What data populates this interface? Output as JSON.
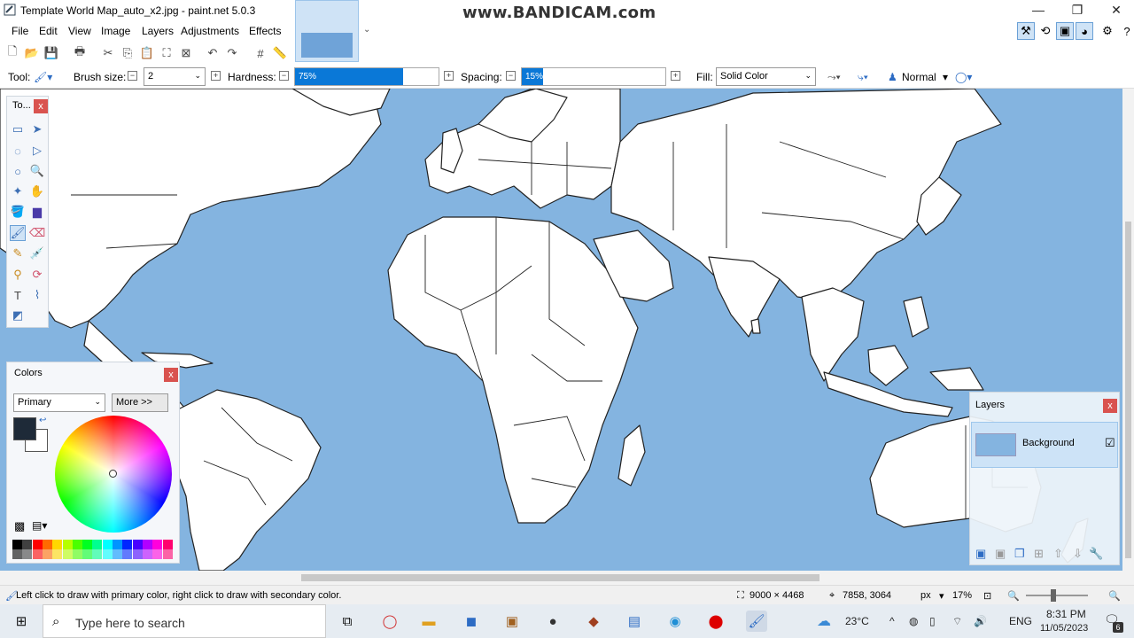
{
  "window": {
    "title": "Template World Map_auto_x2.jpg - paint.net 5.0.3",
    "watermark": "www.BANDICAM.com",
    "minimize": "—",
    "maximize": "❐",
    "close": "✕"
  },
  "menu": {
    "file": "File",
    "edit": "Edit",
    "view": "View",
    "image": "Image",
    "layers": "Layers",
    "adjustments": "Adjustments",
    "effects": "Effects"
  },
  "toolbar": {
    "tool_label": "Tool:",
    "brush_size_label": "Brush size:",
    "brush_size_value": "2",
    "hardness_label": "Hardness:",
    "hardness_value": "75%",
    "hardness_fraction": 0.75,
    "spacing_label": "Spacing:",
    "spacing_value": "15%",
    "spacing_fraction": 0.15,
    "fill_label": "Fill:",
    "fill_value": "Solid Color",
    "blend_mode": "Normal"
  },
  "tools_panel": {
    "title": "To...",
    "close": "x"
  },
  "colors_panel": {
    "title": "Colors",
    "close": "x",
    "mode": "Primary",
    "more_button": "More >>",
    "primary_color": "#1e2a38",
    "secondary_color": "#ffffff"
  },
  "layers_panel": {
    "title": "Layers",
    "close": "x",
    "layer_name": "Background"
  },
  "status": {
    "hint": "Left click to draw with primary color, right click to draw with secondary color.",
    "image_size": "9000 × 4468",
    "cursor_pos": "7858, 3064",
    "units": "px",
    "zoom": "17%"
  },
  "taskbar": {
    "search_placeholder": "Type here to search",
    "weather": "23°C",
    "language": "ENG",
    "time": "8:31 PM",
    "date": "11/05/2023",
    "notification_count": "6"
  },
  "colors": {
    "ocean": "#84b4e0",
    "accent": "#0a78d7"
  }
}
